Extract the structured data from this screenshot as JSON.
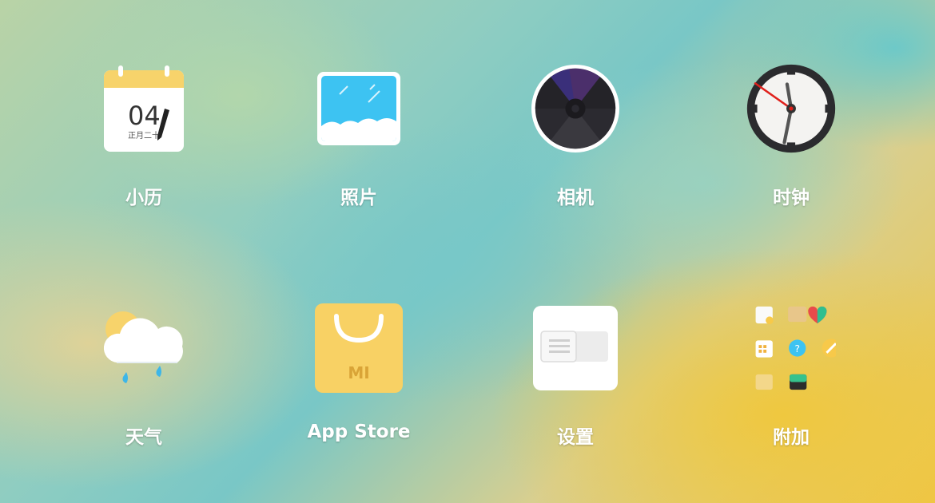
{
  "apps": [
    {
      "name": "小历",
      "icon": "calendar-icon",
      "date_number": "04",
      "date_sub": "正月二十"
    },
    {
      "name": "照片",
      "icon": "photos-icon"
    },
    {
      "name": "相机",
      "icon": "camera-icon"
    },
    {
      "name": "时钟",
      "icon": "clock-icon"
    },
    {
      "name": "天气",
      "icon": "weather-icon"
    },
    {
      "name": "App Store",
      "icon": "app-store-icon",
      "brand": "MI"
    },
    {
      "name": "设置",
      "icon": "settings-icon"
    },
    {
      "name": "附加",
      "icon": "extras-folder-icon"
    }
  ],
  "colors": {
    "calendar_header": "#f7d36b",
    "photos_sky": "#3dc3f2",
    "appstore_bg": "#f8d164",
    "brand_gold": "#d9a437",
    "clock_hand_second": "#e0201b"
  }
}
